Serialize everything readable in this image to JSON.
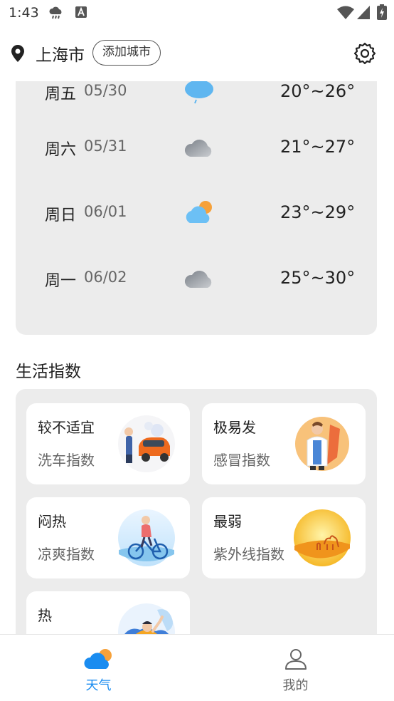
{
  "status_bar": {
    "time": "1:43"
  },
  "header": {
    "city": "上海市",
    "add_city_label": "添加城市"
  },
  "forecast": [
    {
      "day": "周五",
      "date": "05/30",
      "icon": "light-rain-icon",
      "temp": "20°~26°"
    },
    {
      "day": "周六",
      "date": "05/31",
      "icon": "cloudy-icon",
      "temp": "21°~27°"
    },
    {
      "day": "周日",
      "date": "06/01",
      "icon": "partly-cloudy-icon",
      "temp": "23°~29°"
    },
    {
      "day": "周一",
      "date": "06/02",
      "icon": "cloudy-icon",
      "temp": "25°~30°"
    }
  ],
  "life_index": {
    "title": "生活指数",
    "items": [
      {
        "level": "较不适宜",
        "name": "洗车指数",
        "icon": "car-wash-illustration"
      },
      {
        "level": "极易发",
        "name": "感冒指数",
        "icon": "cold-illustration"
      },
      {
        "level": "闷热",
        "name": "凉爽指数",
        "icon": "cycling-illustration"
      },
      {
        "level": "最弱",
        "name": "紫外线指数",
        "icon": "desert-sun-illustration"
      },
      {
        "level": "热",
        "name": "",
        "icon": "waving-person-illustration"
      }
    ]
  },
  "tabs": [
    {
      "label": "天气",
      "icon": "weather-cloud-icon",
      "active": true,
      "color": "#1a8cf0"
    },
    {
      "label": "我的",
      "icon": "user-icon",
      "active": false,
      "color": "#666666"
    }
  ],
  "colors": {
    "accent": "#1a8cf0",
    "card_bg": "#ececec"
  }
}
